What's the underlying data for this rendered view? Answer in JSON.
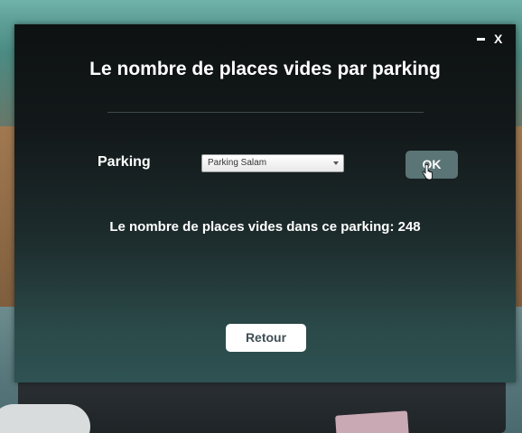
{
  "window": {
    "minimize_label": "",
    "close_label": "X"
  },
  "dialog": {
    "title": "Le nombre de places vides par parking",
    "parking_label": "Parking",
    "parking_select": {
      "selected": "Parking Salam"
    },
    "ok_label": "OK",
    "result_prefix": "Le nombre de places vides dans ce parking:",
    "result_value": "248",
    "retour_label": "Retour"
  },
  "icons": {
    "minimize": "minimize-icon",
    "close": "close-icon",
    "dropdown": "chevron-down-icon",
    "cursor": "hand-pointer-cursor"
  },
  "colors": {
    "dialog_top": "#0d1112",
    "dialog_bottom": "#2f5252",
    "ok_button": "#5b7476",
    "retour_button": "#ffffff",
    "retour_text": "#3f4f55"
  }
}
